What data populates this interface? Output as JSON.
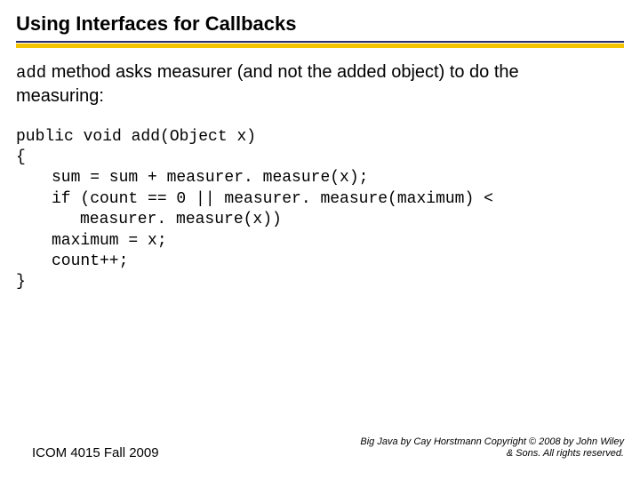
{
  "title": "Using Interfaces for Callbacks",
  "body": {
    "line1_mono": "add",
    "line1_rest": " method asks measurer (and not the added object) to do the",
    "line2": "measuring:"
  },
  "code": {
    "l1": "public void add(Object x)",
    "l2": "{",
    "l3": "sum = sum + measurer. measure(x);",
    "l4": "if (count == 0 || measurer. measure(maximum) <",
    "l5": "measurer. measure(x))",
    "l6": "maximum = x;",
    "l7": "count++;",
    "l8": "}"
  },
  "footer": {
    "left": "ICOM 4015 Fall 2009",
    "right_line1": "Big Java by Cay Horstmann Copyright © 2008 by John Wiley",
    "right_line2": "& Sons. All rights reserved."
  }
}
